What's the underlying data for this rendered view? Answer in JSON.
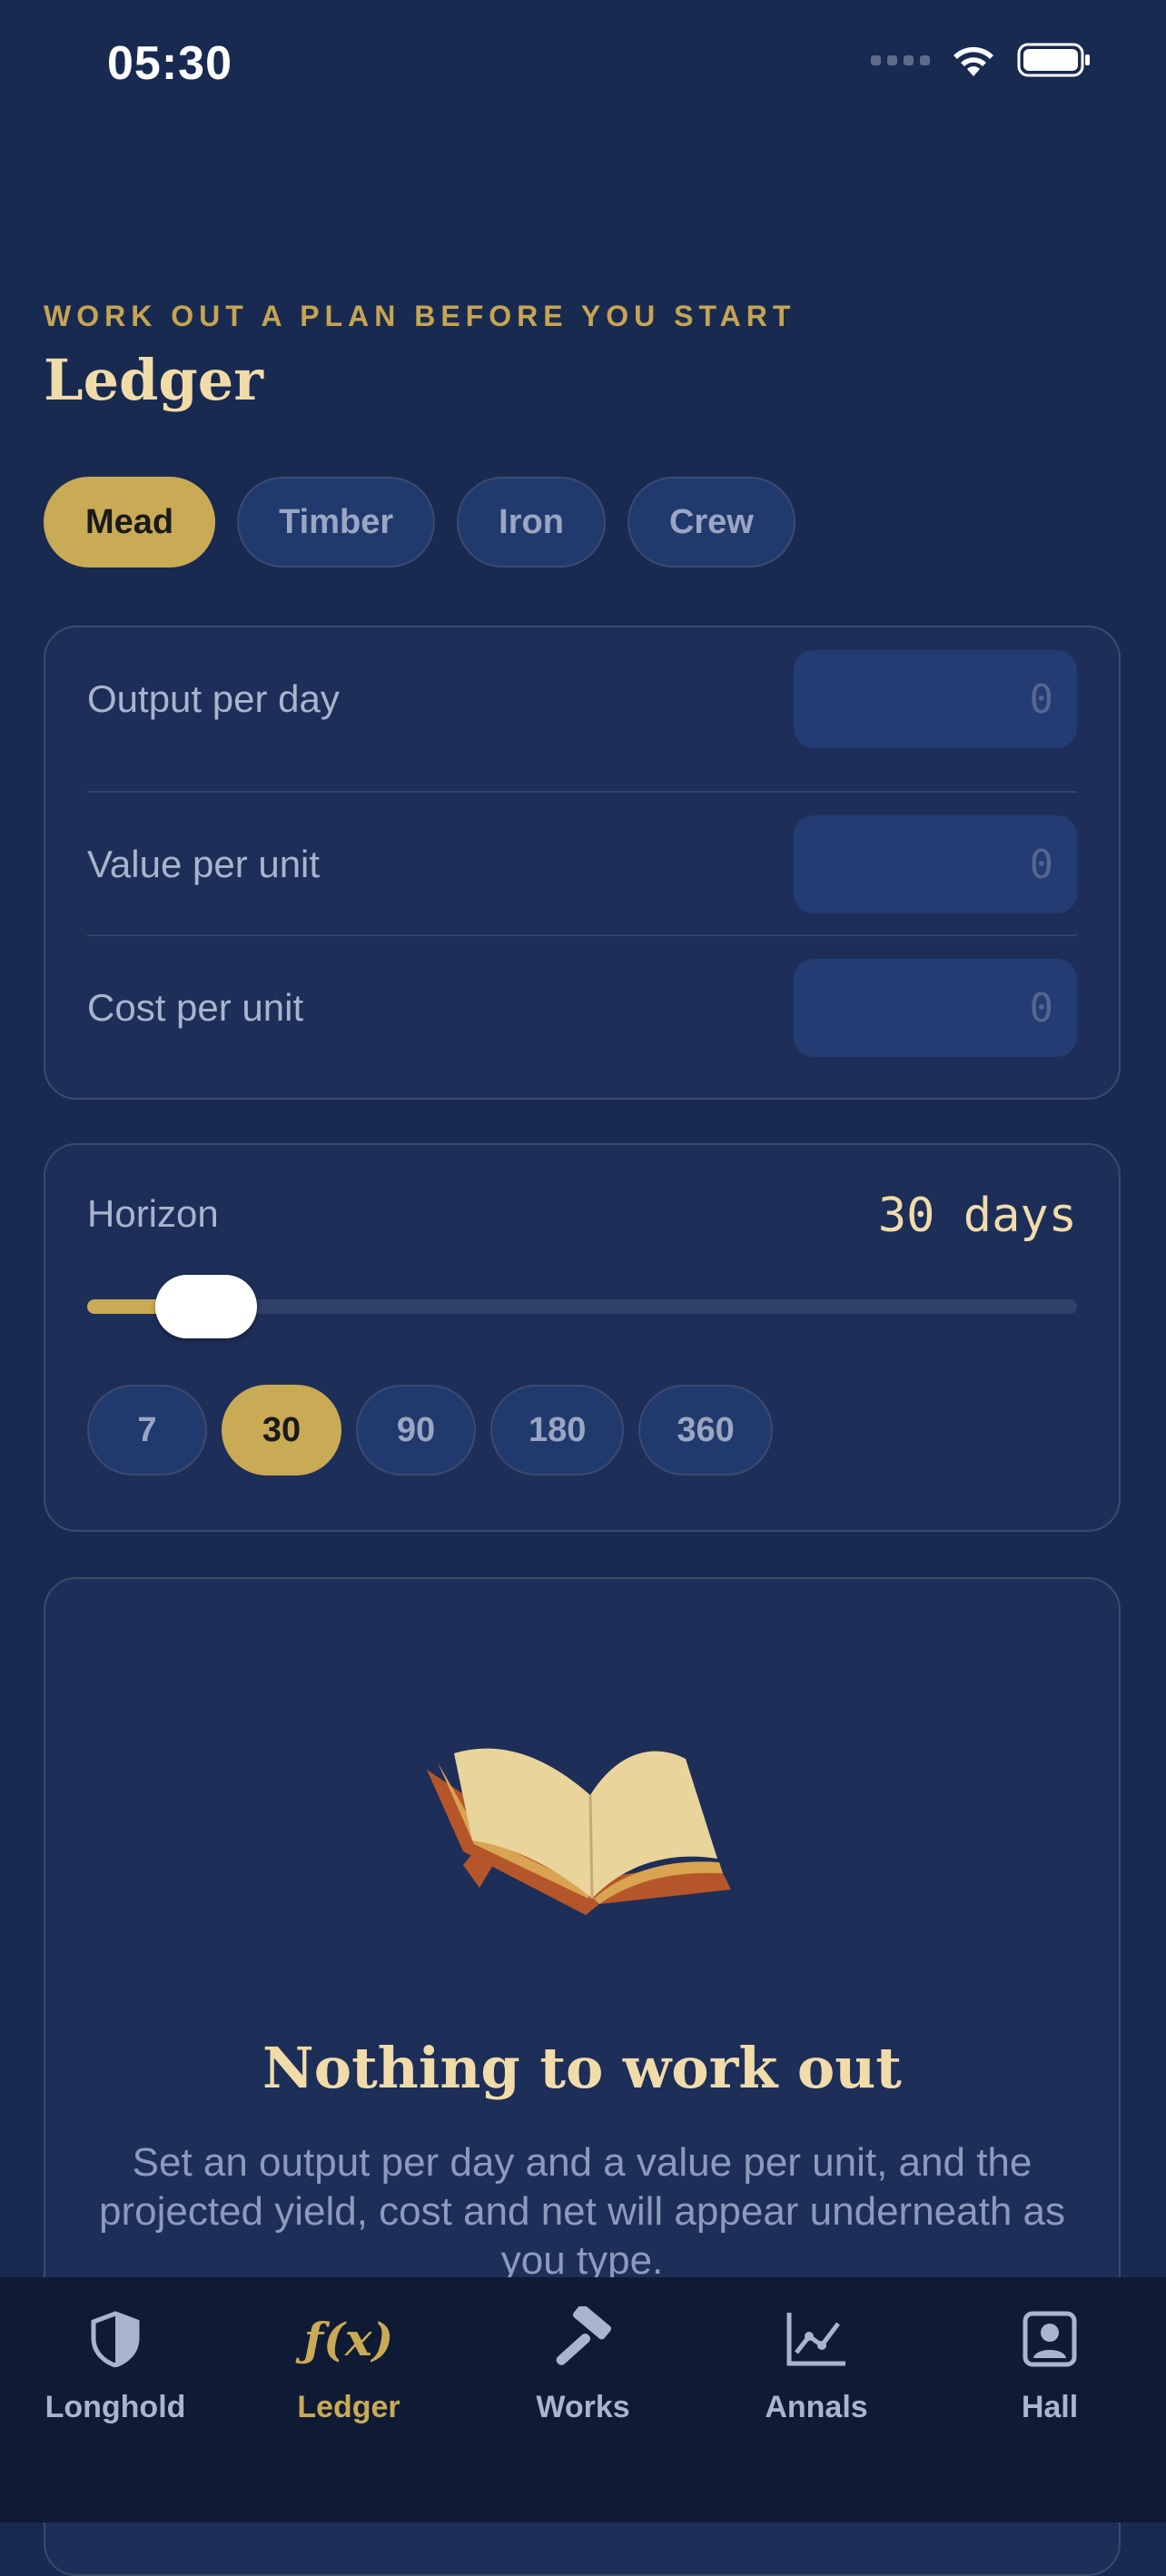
{
  "status": {
    "time": "05:30"
  },
  "header": {
    "eyebrow": "WORK OUT A PLAN BEFORE YOU START",
    "title": "Ledger"
  },
  "resources": [
    {
      "label": "Mead",
      "active": true
    },
    {
      "label": "Timber",
      "active": false
    },
    {
      "label": "Iron",
      "active": false
    },
    {
      "label": "Crew",
      "active": false
    }
  ],
  "inputs": [
    {
      "label": "Output per day",
      "placeholder": "0"
    },
    {
      "label": "Value per unit",
      "placeholder": "0"
    },
    {
      "label": "Cost per unit",
      "placeholder": "0"
    }
  ],
  "horizon": {
    "label": "Horizon",
    "value_text": "30 days",
    "slider_fraction": 0.065,
    "presets": [
      {
        "label": "7",
        "active": false
      },
      {
        "label": "30",
        "active": true
      },
      {
        "label": "90",
        "active": false
      },
      {
        "label": "180",
        "active": false
      },
      {
        "label": "360",
        "active": false
      }
    ]
  },
  "empty": {
    "icon": "open-book-icon",
    "title": "Nothing to work out",
    "body": "Set an output per day and a value per unit, and the projected yield, cost and net will appear underneath as you type."
  },
  "tabs": [
    {
      "label": "Longhold",
      "icon": "shield-icon",
      "active": false
    },
    {
      "label": "Ledger",
      "icon": "function-icon",
      "active": true
    },
    {
      "label": "Works",
      "icon": "hammer-icon",
      "active": false
    },
    {
      "label": "Annals",
      "icon": "chart-icon",
      "active": false
    },
    {
      "label": "Hall",
      "icon": "person-icon",
      "active": false
    }
  ],
  "colors": {
    "accent": "#c9aa55",
    "background": "#192a51",
    "card": "#1d2e58",
    "title": "#f1dca9"
  }
}
